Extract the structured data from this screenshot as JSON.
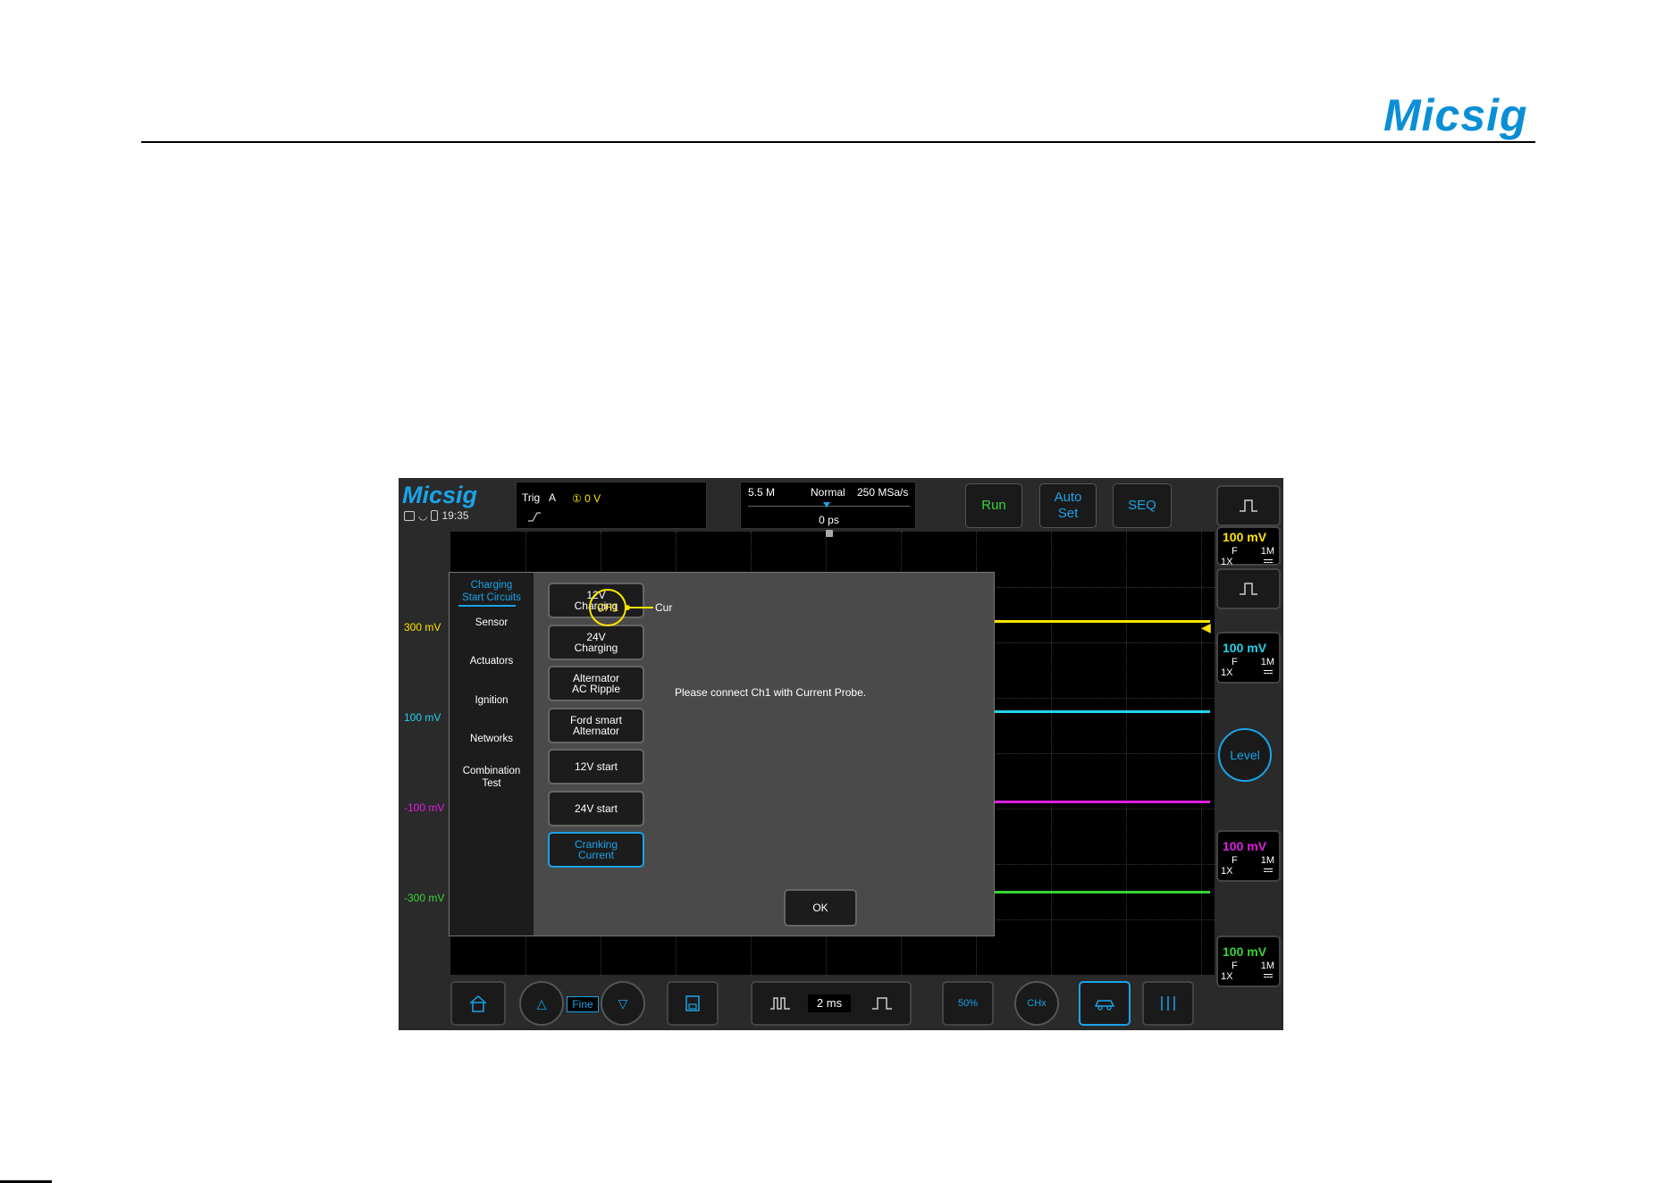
{
  "document": {
    "brand": "Micsig"
  },
  "screen": {
    "brand": "Micsig",
    "clock": "19:35",
    "trigger": {
      "label": "Trig",
      "source": "A",
      "level": "① 0 V"
    },
    "timebase": {
      "memory_depth": "5.5 M",
      "mode": "Normal",
      "sample_rate": "250 MSa/s",
      "delay": "0 ps"
    },
    "top_buttons": {
      "run": "Run",
      "autoset_line1": "Auto",
      "autoset_line2": "Set",
      "seq": "SEQ"
    },
    "y_labels": [
      {
        "text": "300 mV",
        "color": "#ffe600"
      },
      {
        "text": "100 mV",
        "color": "#22d3ee"
      },
      {
        "text": "-100 mV",
        "color": "#e01ee0"
      },
      {
        "text": "-300 mV",
        "color": "#39d439"
      }
    ],
    "channels": [
      {
        "scale": "100 mV",
        "coupling": "F",
        "impedance": "1M",
        "probe": "1X",
        "color": "#ffe600"
      },
      {
        "scale": "100 mV",
        "coupling": "F",
        "impedance": "1M",
        "probe": "1X",
        "color": "#22d3ee"
      },
      {
        "scale": "100 mV",
        "coupling": "F",
        "impedance": "1M",
        "probe": "1X",
        "color": "#e01ee0"
      },
      {
        "scale": "100 mV",
        "coupling": "F",
        "impedance": "1M",
        "probe": "1X",
        "color": "#39d439"
      }
    ],
    "level_button": "Level",
    "dialog": {
      "categories": [
        {
          "line1": "Charging",
          "line2": "Start Circuits"
        },
        {
          "line1": "Sensor",
          "line2": ""
        },
        {
          "line1": "Actuators",
          "line2": ""
        },
        {
          "line1": "Ignition",
          "line2": ""
        },
        {
          "line1": "Networks",
          "line2": ""
        },
        {
          "line1": "Combination",
          "line2": "Test"
        }
      ],
      "tests": [
        {
          "line1": "12V",
          "line2": "Charging"
        },
        {
          "line1": "24V",
          "line2": "Charging"
        },
        {
          "line1": "Alternator",
          "line2": "AC Ripple"
        },
        {
          "line1": "Ford smart",
          "line2": "Alternator"
        },
        {
          "line1": "12V start",
          "line2": ""
        },
        {
          "line1": "24V start",
          "line2": ""
        },
        {
          "line1": "Cranking",
          "line2": "Current"
        }
      ],
      "channel_label": "CH1",
      "probe_label": "Cur",
      "instruction": "Please connect Ch1 with Current Probe.",
      "ok": "OK"
    },
    "bottom_bar": {
      "fine": "Fine",
      "timebase_value": "2 ms",
      "percent": "50%",
      "freq": "CHx"
    },
    "colors": {
      "accent": "#1aa3e8",
      "ch1": "#ffe600",
      "ch2": "#22d3ee",
      "ch3": "#e01ee0",
      "ch4": "#39d439"
    }
  }
}
